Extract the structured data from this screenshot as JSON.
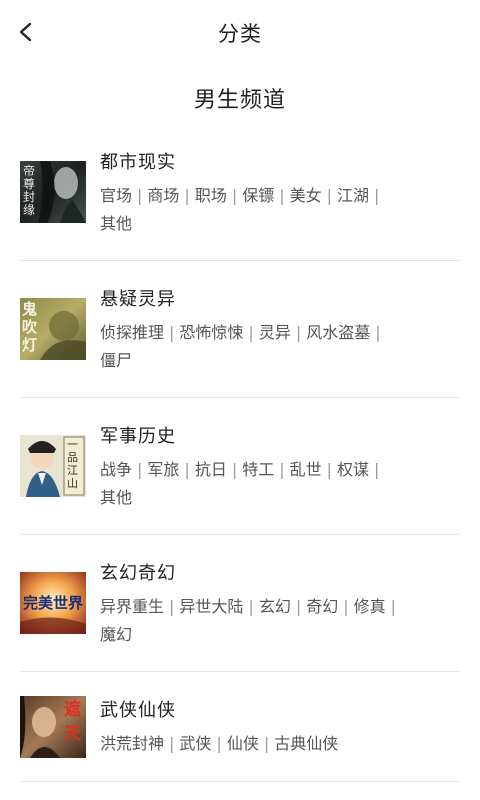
{
  "header": {
    "title": "分类",
    "back_icon": "chevron-left-icon"
  },
  "channel": {
    "title": "男生频道"
  },
  "categories": [
    {
      "name": "都市现实",
      "cover_text": "帝尊封缘",
      "tags": [
        "官场",
        "商场",
        "职场",
        "保镖",
        "美女",
        "江湖",
        "其他"
      ]
    },
    {
      "name": "悬疑灵异",
      "cover_text": "鬼吹灯",
      "tags": [
        "侦探推理",
        "恐怖惊悚",
        "灵异",
        "风水盗墓",
        "僵尸"
      ]
    },
    {
      "name": "军事历史",
      "cover_text": "一品江山",
      "tags": [
        "战争",
        "军旅",
        "抗日",
        "特工",
        "乱世",
        "权谋",
        "其他"
      ]
    },
    {
      "name": "玄幻奇幻",
      "cover_text": "完美世界",
      "tags": [
        "异界重生",
        "异世大陆",
        "玄幻",
        "奇幻",
        "修真",
        "魔幻"
      ]
    },
    {
      "name": "武侠仙侠",
      "cover_text": "遮天",
      "tags": [
        "洪荒封神",
        "武侠",
        "仙侠",
        "古典仙侠"
      ]
    }
  ]
}
